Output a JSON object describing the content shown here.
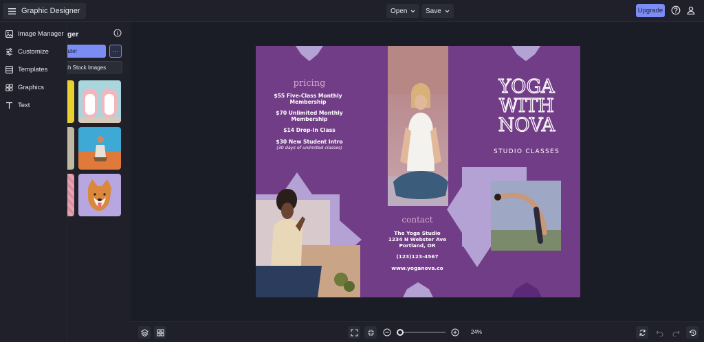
{
  "app": {
    "title": "Graphic Designer"
  },
  "toolbar": {
    "open_label": "Open",
    "save_label": "Save",
    "upgrade_label": "Upgrade"
  },
  "sidebar": {
    "items": [
      {
        "label": "Image Manager",
        "icon": "image-icon"
      },
      {
        "label": "Customize",
        "icon": "sliders-icon"
      },
      {
        "label": "Templates",
        "icon": "templates-icon"
      },
      {
        "label": "Graphics",
        "icon": "shapes-icon"
      },
      {
        "label": "Text",
        "icon": "text-icon"
      }
    ]
  },
  "panel": {
    "title": "ger",
    "computer_label": "puter",
    "more_label": "···",
    "stock_label": "ch Stock Images"
  },
  "brochure": {
    "pricing_title": "pricing",
    "prices": [
      {
        "line1": "$55 Five-Class Monthly",
        "line2": "Membership"
      },
      {
        "line1": "$70 Unlimited Monthly",
        "line2": "Membership"
      },
      {
        "line1": "$14 Drop-In Class",
        "line2": ""
      },
      {
        "line1": "$30 New Student Intro",
        "line2": "(30 days of unlimited classes)"
      }
    ],
    "contact_title": "contact",
    "contact_lines": [
      "The Yoga Studio",
      "1234 N Webster Ave",
      "Portland, OR"
    ],
    "phone": "(123)123-4567",
    "website": "www.yoganova.co",
    "headline": [
      "YOGA",
      "WITH",
      "NOVA"
    ],
    "subtitle": "STUDIO CLASSES"
  },
  "zoom": {
    "label": "24%",
    "level": 0.05
  },
  "colors": {
    "accent": "#7b8cf5",
    "brochure_purple": "#723d87",
    "star_light": "#b4a2d4",
    "star_dark": "#5a2a78"
  }
}
